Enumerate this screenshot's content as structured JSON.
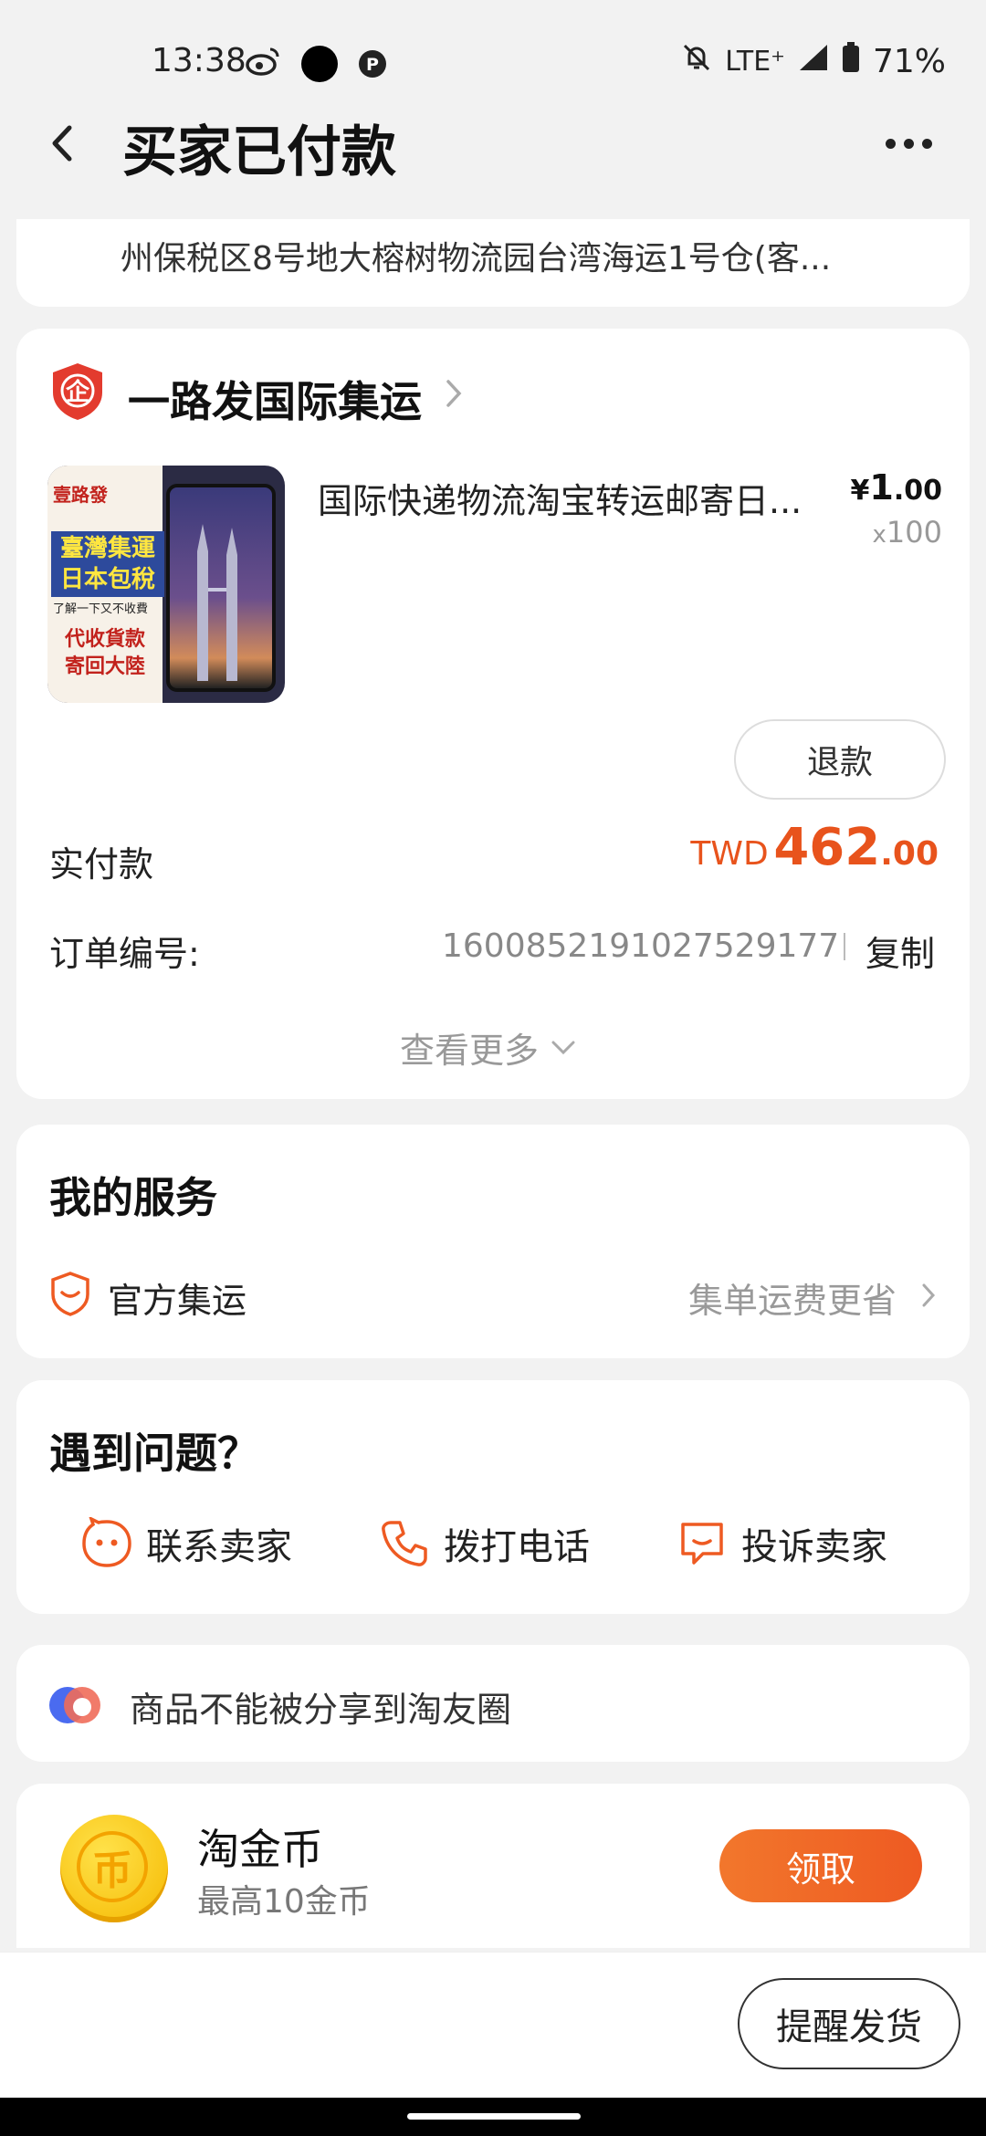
{
  "status_bar": {
    "time": "13:38",
    "network": "LTE⁺",
    "battery": "71%"
  },
  "header": {
    "title": "买家已付款"
  },
  "address": {
    "text": "州保税区8号地大榕树物流园台湾海运1号仓(客..."
  },
  "order": {
    "shop_name": "一路发国际集运",
    "product_title": "国际快递物流淘宝转运邮寄日...",
    "price_symbol": "¥",
    "price_int": "1",
    "price_dec": ".00",
    "qty_x": "x",
    "qty": "100",
    "refund_label": "退款",
    "paid_label": "实付款",
    "paid_currency": "TWD",
    "paid_int": "462",
    "paid_dec": ".00",
    "order_no_label": "订单编号:",
    "order_no": "1600852191027529177",
    "copy_label": "复制",
    "see_more": "查看更多",
    "image_text": {
      "brand": "壹路發",
      "line1": "臺灣集運",
      "line2": "日本包稅",
      "line3": "了解一下又不收費",
      "line4": "代收貨款",
      "line5": "寄回大陸"
    }
  },
  "services": {
    "title": "我的服务",
    "item_label": "官方集运",
    "item_hint": "集单运费更省"
  },
  "problems": {
    "title": "遇到问题？",
    "items": [
      {
        "label": "联系卖家",
        "icon": "chat-bubble-face-icon"
      },
      {
        "label": "拨打电话",
        "icon": "phone-icon"
      },
      {
        "label": "投诉卖家",
        "icon": "complaint-icon"
      }
    ]
  },
  "share": {
    "text": "商品不能被分享到淘友圈"
  },
  "coins": {
    "title": "淘金币",
    "subtitle": "最高10金币",
    "coin_char": "币",
    "claim_label": "领取"
  },
  "bottom": {
    "remind_label": "提醒发货"
  },
  "colors": {
    "accent": "#ee5a22",
    "price": "#e8531c",
    "background": "#f2f2f2"
  }
}
